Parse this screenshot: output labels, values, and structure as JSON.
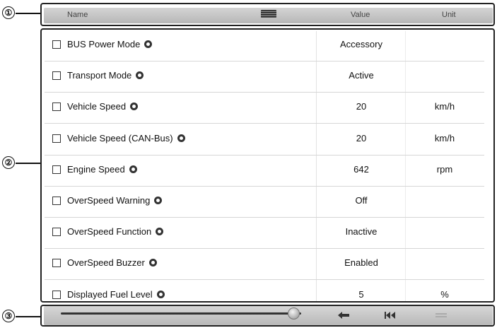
{
  "callouts": [
    "①",
    "②",
    "③"
  ],
  "header": {
    "name_label": "Name",
    "value_label": "Value",
    "unit_label": "Unit"
  },
  "rows": [
    {
      "name": "BUS Power Mode",
      "value": "Accessory",
      "unit": ""
    },
    {
      "name": "Transport Mode",
      "value": "Active",
      "unit": ""
    },
    {
      "name": "Vehicle Speed",
      "value": "20",
      "unit": "km/h"
    },
    {
      "name": "Vehicle Speed (CAN-Bus)",
      "value": "20",
      "unit": "km/h"
    },
    {
      "name": "Engine Speed",
      "value": "642",
      "unit": "rpm"
    },
    {
      "name": "OverSpeed Warning",
      "value": "Off",
      "unit": ""
    },
    {
      "name": "OverSpeed Function",
      "value": "Inactive",
      "unit": ""
    },
    {
      "name": "OverSpeed Buzzer",
      "value": "Enabled",
      "unit": ""
    },
    {
      "name": "Displayed Fuel Level",
      "value": "5",
      "unit": "%"
    }
  ],
  "toolbar": {
    "icons": [
      "back-arrow-icon",
      "skip-to-start-icon",
      "menu-icon"
    ],
    "slider_position": 0.97
  },
  "colors": {
    "bar_top": "#d4d4d4",
    "bar_bottom": "#b7b7b7",
    "row_divider": "#d6d6d6"
  }
}
